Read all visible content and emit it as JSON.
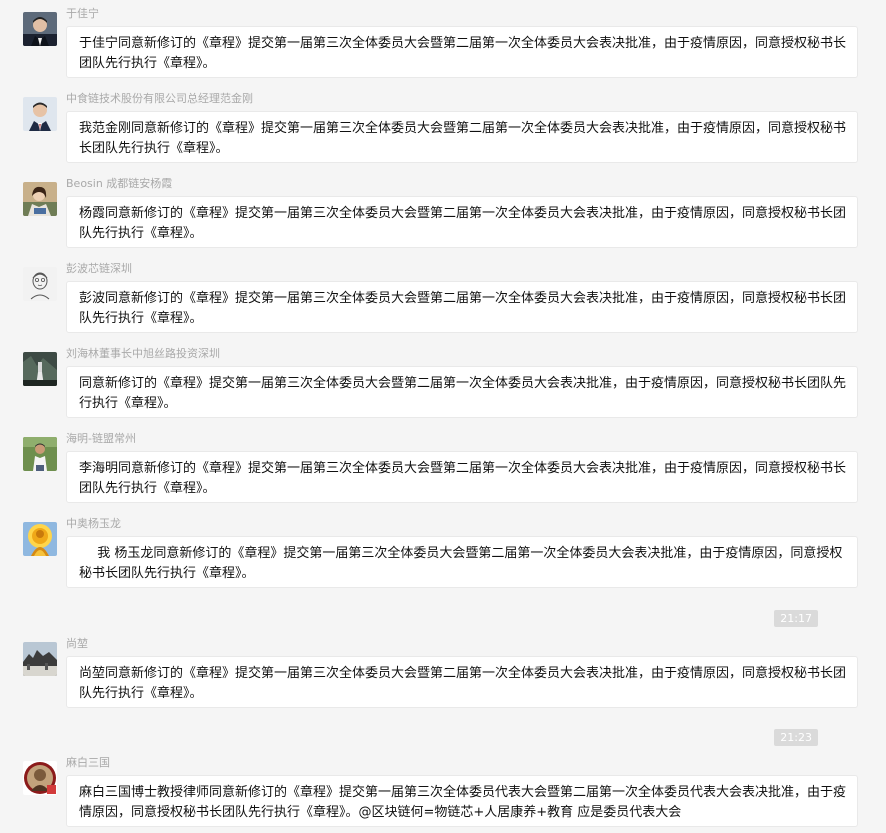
{
  "messages": [
    {
      "sender": "于佳宁",
      "avatar_icon": "avatar-yujianing",
      "text": "于佳宁同意新修订的《章程》提交第一届第三次全体委员大会暨第二届第一次全体委员大会表决批准，由于疫情原因，同意授权秘书长团队先行执行《章程》。"
    },
    {
      "sender": "中食链技术股份有限公司总经理范金刚",
      "avatar_icon": "avatar-fanjingang",
      "text": "我范金刚同意新修订的《章程》提交第一届第三次全体委员大会暨第二届第一次全体委员大会表决批准，由于疫情原因，同意授权秘书长团队先行执行《章程》。"
    },
    {
      "sender": "Beosin 成都链安杨霞",
      "avatar_icon": "avatar-yangxia",
      "text": "杨霞同意新修订的《章程》提交第一届第三次全体委员大会暨第二届第一次全体委员大会表决批准，由于疫情原因，同意授权秘书长团队先行执行《章程》。"
    },
    {
      "sender": "彭波芯链深圳",
      "avatar_icon": "avatar-pengbo",
      "text": "彭波同意新修订的《章程》提交第一届第三次全体委员大会暨第二届第一次全体委员大会表决批准，由于疫情原因，同意授权秘书长团队先行执行《章程》。"
    },
    {
      "sender": "刘海林董事长中旭丝路投资深圳",
      "avatar_icon": "avatar-liuhailin",
      "text": "同意新修订的《章程》提交第一届第三次全体委员大会暨第二届第一次全体委员大会表决批准，由于疫情原因，同意授权秘书长团队先行执行《章程》。"
    },
    {
      "sender": "海明-链盟常州",
      "avatar_icon": "avatar-haiming",
      "text": "李海明同意新修订的《章程》提交第一届第三次全体委员大会暨第二届第一次全体委员大会表决批准，由于疫情原因，同意授权秘书长团队先行执行《章程》。"
    },
    {
      "sender": "中奥杨玉龙",
      "avatar_icon": "avatar-yangyulong",
      "text": "我 杨玉龙同意新修订的《章程》提交第一届第三次全体委员大会暨第二届第一次全体委员大会表决批准，由于疫情原因，同意授权秘书长团队先行执行《章程》。"
    },
    {
      "sender": "尚堃",
      "avatar_icon": "avatar-shangkun",
      "text": "尚堃同意新修订的《章程》提交第一届第三次全体委员大会暨第二届第一次全体委员大会表决批准，由于疫情原因，同意授权秘书长团队先行执行《章程》。"
    },
    {
      "sender": "麻白三国",
      "avatar_icon": "avatar-mabaisanguo",
      "text": "麻白三国博士教授律师同意新修订的《章程》提交第一届第三次全体委员代表大会暨第二届第一次全体委员代表大会表决批准，由于疫情原因，同意授权秘书长团队先行执行《章程》。@区块链何=物链芯+人居康养+教育 应是委员代表大会"
    }
  ],
  "timestamps": [
    "21:17",
    "21:23"
  ],
  "colors": {
    "background": "#f5f5f5",
    "bubble": "#ffffff",
    "sender_text": "#a9a9a9",
    "message_text": "#111111",
    "time_badge": "#dadada"
  }
}
